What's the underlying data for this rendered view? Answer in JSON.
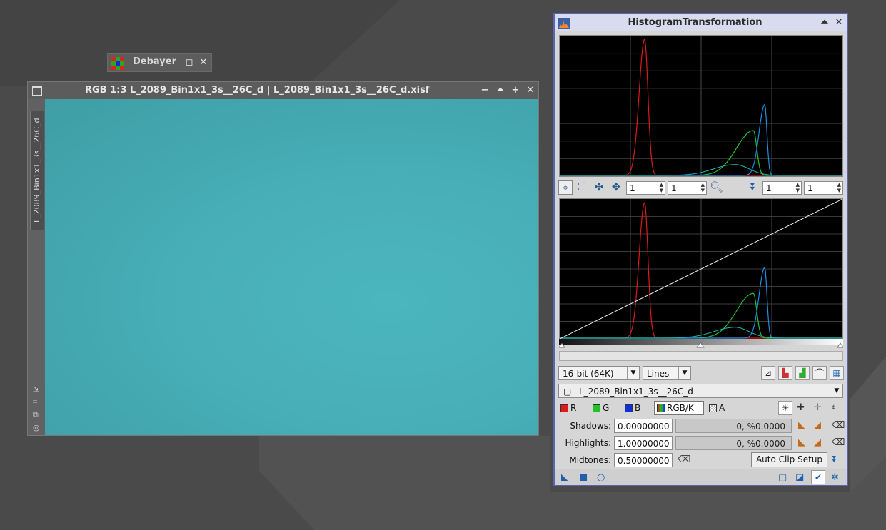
{
  "debayer": {
    "title": "Debayer"
  },
  "image_window": {
    "title": "RGB 1:3 L_2089_Bin1x1_3s__26C_d | L_2089_Bin1x1_3s__26C_d.xisf",
    "view_tab": "L_2089_Bin1x1_3s__26C_d"
  },
  "histogram": {
    "title": "HistogramTransformation",
    "zoom": {
      "h1": "1",
      "v1": "1",
      "h2": "1",
      "v2": "1"
    },
    "resolution": "16-bit (64K)",
    "graph_style": "Lines",
    "view": "L_2089_Bin1x1_3s__26C_d",
    "channels": {
      "r": "R",
      "g": "G",
      "b": "B",
      "rgbk": "RGB/K",
      "a": "A"
    },
    "shadows": {
      "label": "Shadows:",
      "value": "0.00000000",
      "clip": "0, %0.0000"
    },
    "highlights": {
      "label": "Highlights:",
      "value": "1.00000000",
      "clip": "0, %0.0000"
    },
    "midtones": {
      "label": "Midtones:",
      "value": "0.50000000"
    },
    "auto_clip": "Auto Clip Setup"
  },
  "colors": {
    "red": "#e0191b",
    "green": "#22c22a",
    "blue": "#1c8fe6",
    "window_border": "#5b63b5"
  }
}
